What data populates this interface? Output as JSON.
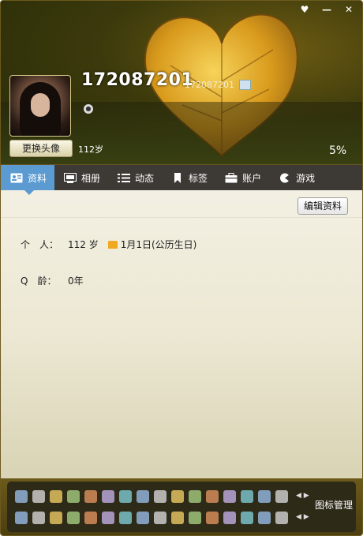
{
  "window": {
    "buttons": [
      {
        "name": "skin-button",
        "glyph": "♥"
      },
      {
        "name": "minimize-button",
        "glyph": "—"
      },
      {
        "name": "close-button",
        "glyph": "✕"
      }
    ]
  },
  "profile": {
    "nickname": "172087201",
    "qq_number": "172087201",
    "age_short": "112岁",
    "completion": "5%",
    "change_avatar_label": "更换头像"
  },
  "tabs": [
    {
      "label": "资料",
      "icon": "id-card-icon",
      "active": true
    },
    {
      "label": "相册",
      "icon": "photo-album-icon",
      "active": false
    },
    {
      "label": "动态",
      "icon": "feed-list-icon",
      "active": false
    },
    {
      "label": "标签",
      "icon": "bookmark-tag-icon",
      "active": false
    },
    {
      "label": "账户",
      "icon": "wallet-icon",
      "active": false
    },
    {
      "label": "游戏",
      "icon": "game-icon",
      "active": false
    }
  ],
  "toolbar": {
    "edit_label": "编辑资料"
  },
  "details": {
    "personal_label": "个　人：",
    "personal_age": "112 岁",
    "birthday": "1月1日(公历生日)",
    "qage_label": "Q　龄：",
    "qage_value": "0年"
  },
  "iconbar": {
    "manage_label": "图标管理",
    "row1_icons": [
      "qq-icon",
      "diamond-icon",
      "user-icon",
      "monitor-icon",
      "gem-icon",
      "gem-icon",
      "gem-icon",
      "gem-icon",
      "heart-icon",
      "bird-icon",
      "star-icon",
      "gem-icon",
      "gem-icon",
      "gem-icon",
      "gem-icon",
      "gem-icon"
    ],
    "row2_icons": [
      "star-icon",
      "ie-icon",
      "music-icon",
      "photo-icon",
      "chat-icon",
      "app-icon",
      "game-icon",
      "penguin-icon",
      "shield-icon",
      "puzzle-icon",
      "mail-icon",
      "camera-icon",
      "disc-icon",
      "tools-icon",
      "security-icon",
      "box-icon"
    ]
  }
}
